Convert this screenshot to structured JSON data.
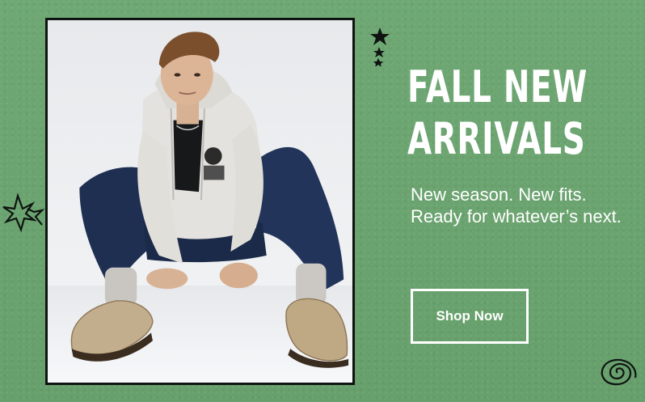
{
  "banner": {
    "headline_line1": "FALL NEW",
    "headline_line2": "ARRIVALS",
    "subcopy": "New season. New fits. Ready for whatever’s next.",
    "cta_label": "Shop Now",
    "colors": {
      "background": "#6aa56f",
      "text": "#ffffff",
      "frame": "#0f1412"
    }
  },
  "image": {
    "alt": "Model in a grey zip hoodie, black tee, dark wide-leg jeans and suede clogs seated on the floor"
  }
}
